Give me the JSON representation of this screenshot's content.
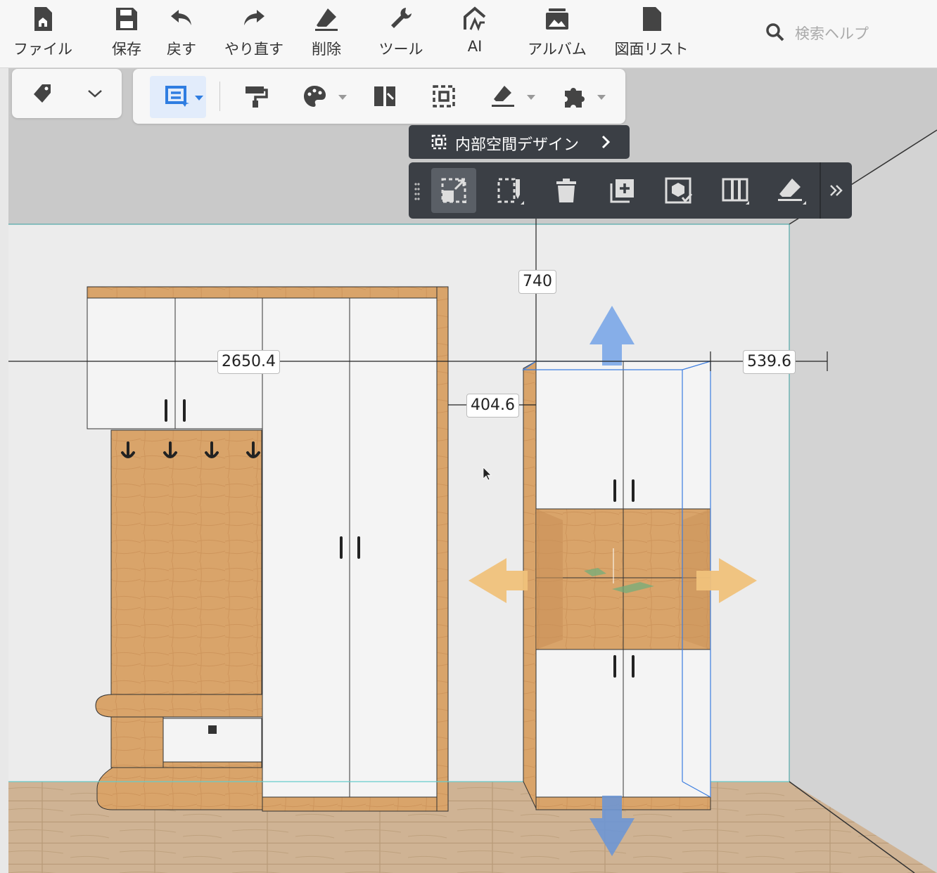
{
  "toolbar": {
    "items": [
      {
        "label": "ファイル",
        "icon": "file-home-icon"
      },
      {
        "label": "保存",
        "icon": "save-icon"
      },
      {
        "label": "戻す",
        "icon": "undo-icon"
      },
      {
        "label": "やり直す",
        "icon": "redo-icon"
      },
      {
        "label": "削除",
        "icon": "eraser-icon"
      },
      {
        "label": "ツール",
        "icon": "wrench-icon"
      },
      {
        "label": "AI",
        "icon": "ai-icon"
      },
      {
        "label": "アルバム",
        "icon": "album-icon"
      },
      {
        "label": "図面リスト",
        "icon": "drawing-list-icon"
      }
    ],
    "search_placeholder": "検索ヘルプ"
  },
  "context_panel": {
    "design_label": "内部空間デザイン"
  },
  "dimensions": {
    "height_above": "740",
    "total_width": "2650.4",
    "gap_left": "404.6",
    "gap_right": "539.6"
  },
  "colors": {
    "accent": "#2f7de1",
    "dark_panel": "#3b3f45",
    "wood": "#d9a46a",
    "arrow_blue": "#7ba7e8",
    "arrow_orange": "#f0c27b"
  }
}
